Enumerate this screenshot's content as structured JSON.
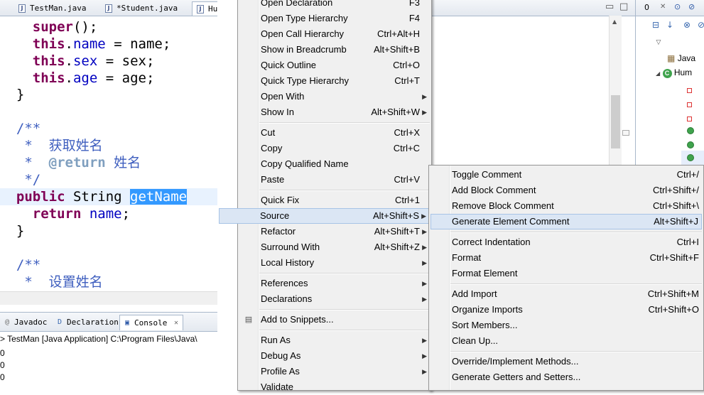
{
  "editor_tabs": [
    {
      "label": "TestMan.java",
      "active": false
    },
    {
      "label": "*Student.java",
      "active": false
    },
    {
      "label": "Hu",
      "active": true
    }
  ],
  "code": {
    "l1": {
      "kw": "super",
      "rest": "();"
    },
    "l2": {
      "kw": "this",
      "dot": ".",
      "field": "name",
      "rest": " = name;"
    },
    "l3": {
      "kw": "this",
      "dot": ".",
      "field": "sex",
      "rest": " = sex;"
    },
    "l4": {
      "kw": "this",
      "dot": ".",
      "field": "age",
      "rest": " = age;"
    },
    "l5": "}",
    "l6": "/**",
    "l7": " *  获取姓名",
    "l8_tag": "@return",
    "l8_rest": " 姓名",
    "l9": " */",
    "l10": {
      "kw": "public",
      "type": " String ",
      "selected": "getName"
    },
    "l11": {
      "kw": "return",
      "field": "name",
      "rest": ";"
    },
    "l12": "}",
    "l13": "/**",
    "l14": " *  设置姓名"
  },
  "bottom_tabs": [
    {
      "label": "Javadoc",
      "icon": "@",
      "active": false
    },
    {
      "label": "Declaration",
      "icon": "D",
      "active": false
    },
    {
      "label": "Console",
      "icon": "▣",
      "active": true,
      "close": "✕"
    }
  ],
  "console": {
    "header": "> TestMan [Java Application] C:\\Program Files\\Java\\",
    "lines": [
      "0",
      "0",
      "0"
    ]
  },
  "outline": {
    "tab": "0",
    "tab_close": "✕",
    "rows": [
      "Java",
      "Hum"
    ]
  },
  "menu": {
    "items": [
      {
        "label": "Open Declaration",
        "shortcut": "F3"
      },
      {
        "label": "Open Type Hierarchy",
        "shortcut": "F4"
      },
      {
        "label": "Open Call Hierarchy",
        "shortcut": "Ctrl+Alt+H"
      },
      {
        "label": "Show in Breadcrumb",
        "shortcut": "Alt+Shift+B"
      },
      {
        "label": "Quick Outline",
        "shortcut": "Ctrl+O"
      },
      {
        "label": "Quick Type Hierarchy",
        "shortcut": "Ctrl+T"
      },
      {
        "label": "Open With",
        "shortcut": ""
      },
      {
        "label": "Show In",
        "shortcut": "Alt+Shift+W"
      },
      {
        "label": "Cut",
        "shortcut": "Ctrl+X"
      },
      {
        "label": "Copy",
        "shortcut": "Ctrl+C"
      },
      {
        "label": "Copy Qualified Name",
        "shortcut": ""
      },
      {
        "label": "Paste",
        "shortcut": "Ctrl+V"
      },
      {
        "label": "Quick Fix",
        "shortcut": "Ctrl+1"
      },
      {
        "label": "Source",
        "shortcut": "Alt+Shift+S"
      },
      {
        "label": "Refactor",
        "shortcut": "Alt+Shift+T"
      },
      {
        "label": "Surround With",
        "shortcut": "Alt+Shift+Z"
      },
      {
        "label": "Local History",
        "shortcut": ""
      },
      {
        "label": "References",
        "shortcut": ""
      },
      {
        "label": "Declarations",
        "shortcut": ""
      },
      {
        "label": "Add to Snippets...",
        "shortcut": ""
      },
      {
        "label": "Run As",
        "shortcut": ""
      },
      {
        "label": "Debug As",
        "shortcut": ""
      },
      {
        "label": "Profile As",
        "shortcut": ""
      },
      {
        "label": "Validate",
        "shortcut": ""
      }
    ],
    "submenu_arrow": "▶"
  },
  "source_submenu": {
    "items": [
      {
        "label": "Toggle Comment",
        "shortcut": "Ctrl+/"
      },
      {
        "label": "Add Block Comment",
        "shortcut": "Ctrl+Shift+/"
      },
      {
        "label": "Remove Block Comment",
        "shortcut": "Ctrl+Shift+\\"
      },
      {
        "label": "Generate Element Comment",
        "shortcut": "Alt+Shift+J"
      },
      {
        "label": "Correct Indentation",
        "shortcut": "Ctrl+I"
      },
      {
        "label": "Format",
        "shortcut": "Ctrl+Shift+F"
      },
      {
        "label": "Format Element",
        "shortcut": ""
      },
      {
        "label": "Add Import",
        "shortcut": "Ctrl+Shift+M"
      },
      {
        "label": "Organize Imports",
        "shortcut": "Ctrl+Shift+O"
      },
      {
        "label": "Sort Members...",
        "shortcut": ""
      },
      {
        "label": "Clean Up...",
        "shortcut": ""
      },
      {
        "label": "Override/Implement Methods...",
        "shortcut": ""
      },
      {
        "label": "Generate Getters and Setters...",
        "shortcut": ""
      }
    ]
  }
}
